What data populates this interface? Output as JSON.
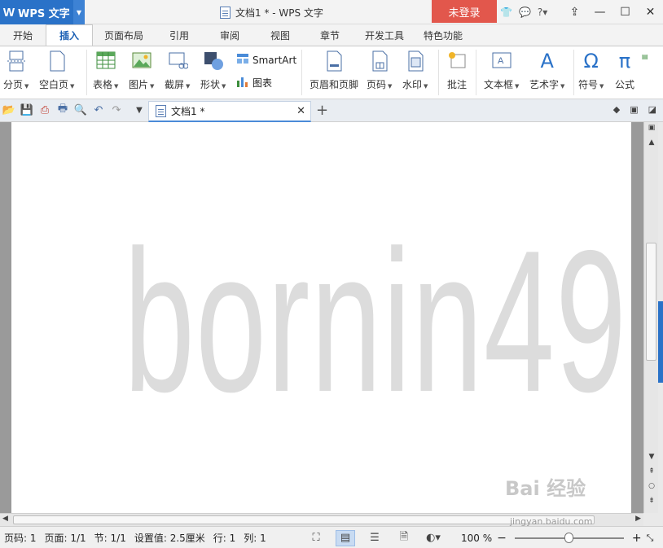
{
  "app": {
    "name": "WPS 文字",
    "logo_letter": "W"
  },
  "window": {
    "title": "文档1 * - WPS 文字",
    "login_label": "未登录",
    "help": "?"
  },
  "tabs": [
    "开始",
    "插入",
    "页面布局",
    "引用",
    "审阅",
    "视图",
    "章节",
    "开发工具",
    "特色功能"
  ],
  "active_tab": "插入",
  "ribbon": {
    "page_break": "分页",
    "blank_page": "空白页",
    "table": "表格",
    "picture": "图片",
    "screenshot": "截屏",
    "shapes": "形状",
    "smartart": "SmartArt",
    "chart": "图表",
    "header_footer": "页眉和页脚",
    "page_number": "页码",
    "watermark": "水印",
    "comment": "批注",
    "text_box": "文本框",
    "word_art": "艺术字",
    "symbol": "符号",
    "formula": "公式",
    "symbol_glyph": "Ω",
    "formula_glyph": "π",
    "wordart_glyph": "A"
  },
  "doc_tab": {
    "name": "文档1 *"
  },
  "document": {
    "watermark_text": "bornin49"
  },
  "status": {
    "page_code": "页码: 1",
    "pages": "页面: 1/1",
    "section": "节: 1/1",
    "setting": "设置值: 2.5厘米",
    "line": "行: 1",
    "column": "列: 1",
    "zoom": "100 %"
  },
  "zoom_level": 0.5,
  "overlay": {
    "brand": "Bai 经验",
    "url": "jingyan.baidu.com"
  }
}
